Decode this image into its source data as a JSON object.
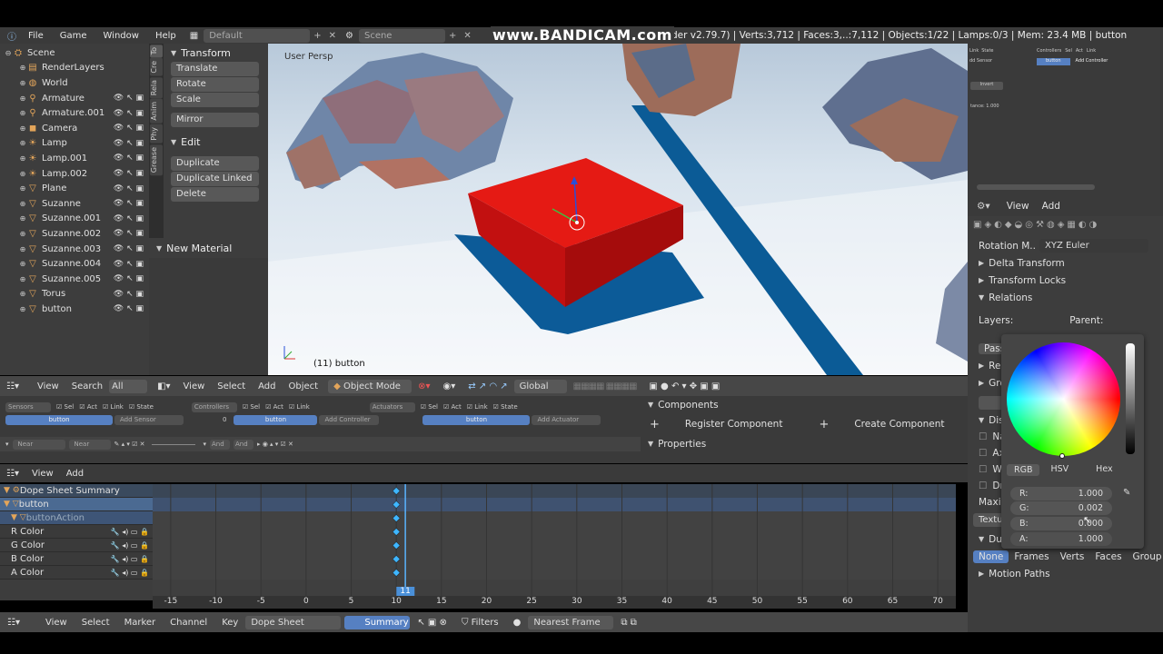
{
  "topbar": {
    "menus": [
      "File",
      "Game",
      "Window",
      "Help"
    ],
    "layout": "Default",
    "scene": "Scene",
    "watermark": "www.BANDICAM.com",
    "info": "n Blender v2.79.7) | Verts:3,712 | Faces:3,..:7,112 | Objects:1/22 | Lamps:0/3 | Mem: 23.4 MB | button"
  },
  "outliner": {
    "items": [
      {
        "label": "Scene",
        "icon": "scene-icon",
        "indent": 0
      },
      {
        "label": "RenderLayers",
        "icon": "renderlayers-icon",
        "indent": 1
      },
      {
        "label": "World",
        "icon": "world-icon",
        "indent": 1
      },
      {
        "label": "Armature",
        "icon": "armature-icon",
        "indent": 1
      },
      {
        "label": "Armature.001",
        "icon": "armature-icon",
        "indent": 1
      },
      {
        "label": "Camera",
        "icon": "camera-icon",
        "indent": 1
      },
      {
        "label": "Lamp",
        "icon": "lamp-icon",
        "indent": 1
      },
      {
        "label": "Lamp.001",
        "icon": "lamp-icon",
        "indent": 1
      },
      {
        "label": "Lamp.002",
        "icon": "lamp-icon",
        "indent": 1
      },
      {
        "label": "Plane",
        "icon": "mesh-icon",
        "indent": 1
      },
      {
        "label": "Suzanne",
        "icon": "mesh-icon",
        "indent": 1
      },
      {
        "label": "Suzanne.001",
        "icon": "mesh-icon",
        "indent": 1
      },
      {
        "label": "Suzanne.002",
        "icon": "mesh-icon",
        "indent": 1
      },
      {
        "label": "Suzanne.003",
        "icon": "mesh-icon",
        "indent": 1
      },
      {
        "label": "Suzanne.004",
        "icon": "mesh-icon",
        "indent": 1
      },
      {
        "label": "Suzanne.005",
        "icon": "mesh-icon",
        "indent": 1
      },
      {
        "label": "Torus",
        "icon": "mesh-icon",
        "indent": 1
      },
      {
        "label": "button",
        "icon": "mesh-icon",
        "indent": 1
      }
    ]
  },
  "shelf": {
    "tabs": [
      "To",
      "Cre",
      "Rela",
      "Anim",
      "Phy",
      "Grease"
    ],
    "transform_title": "Transform",
    "translate": "Translate",
    "rotate": "Rotate",
    "scale": "Scale",
    "mirror": "Mirror",
    "edit_title": "Edit",
    "duplicate": "Duplicate",
    "duplicate_linked": "Duplicate Linked",
    "delete": "Delete",
    "new_material": "New Material"
  },
  "viewport": {
    "label": "User Persp",
    "object_label": "(11) button",
    "cube_color": "#e01010"
  },
  "view3d_header": {
    "menus": [
      "View",
      "Select",
      "Add",
      "Object"
    ],
    "mode": "Object Mode",
    "orientation": "Global"
  },
  "logic_header": {
    "menus": [
      "View",
      "Search"
    ],
    "all_scenes": "All Scen"
  },
  "logic": {
    "sensors": "Sensors",
    "controllers": "Controllers",
    "actuators": "Actuators",
    "sel": "Sel",
    "act": "Act",
    "link": "Link",
    "state": "State",
    "button": "button",
    "add_sensor": "Add Sensor",
    "add_controller": "Add Controller",
    "add_actuator": "Add Actuator",
    "near": "Near",
    "and": "And",
    "zero": "0"
  },
  "props": {
    "components": "Components",
    "register": "Register Component",
    "create": "Create Component",
    "properties": "Properties"
  },
  "dope_header": {
    "menus": [
      "View",
      "Add"
    ]
  },
  "dope": {
    "rows": [
      "Dope Sheet Summary",
      "button",
      "buttonAction",
      "R Color",
      "G Color",
      "B Color",
      "A Color"
    ],
    "current_frame": "11",
    "ticks": [
      "-15",
      "-10",
      "-5",
      "0",
      "5",
      "10",
      "15",
      "20",
      "25",
      "30",
      "35",
      "40",
      "45",
      "50",
      "55",
      "60",
      "65",
      "70"
    ]
  },
  "bottombar": {
    "menus": [
      "View",
      "Select",
      "Marker",
      "Channel",
      "Key"
    ],
    "mode": "Dope Sheet",
    "summary": "Summary",
    "filters": "Filters",
    "nearest": "Nearest Frame"
  },
  "rprops": {
    "header": [
      "View",
      "Add"
    ],
    "rotation_mode_label": "Rotation M..",
    "rotation_mode": "XYZ Euler",
    "delta": "Delta Transform",
    "locks": "Transform Locks",
    "relations": "Relations",
    "layers": "Layers:",
    "parent": "Parent:",
    "pass": "Pass",
    "rel": "Rel",
    "gro": "Gro",
    "disp": "Disp",
    "na": "Na",
    "ax": "Ax",
    "w": "W",
    "dr": "Dr",
    "maxi": "Maxi",
    "textured": "Textured",
    "duplication": "Duplication",
    "dup_opts": [
      "None",
      "Frames",
      "Verts",
      "Faces",
      "Group"
    ],
    "motion": "Motion Paths",
    "obj_color": "#ee0a0a"
  },
  "picker": {
    "tabs": [
      "RGB",
      "HSV",
      "Hex"
    ],
    "r_label": "R:",
    "r": "1.000",
    "g_label": "G:",
    "g": "0.002",
    "b_label": "B:",
    "b": "0.000",
    "a_label": "A:",
    "a": "1.000"
  },
  "mini_logic": {
    "link": "Link",
    "state": "State",
    "controllers": "Controllers",
    "sel": "Sel",
    "act": "Act",
    "button": "button",
    "add_controller": "Add Controller",
    "dd_sensor": "dd Sensor",
    "invert": "Invert",
    "distance": "tance: 1.000"
  }
}
